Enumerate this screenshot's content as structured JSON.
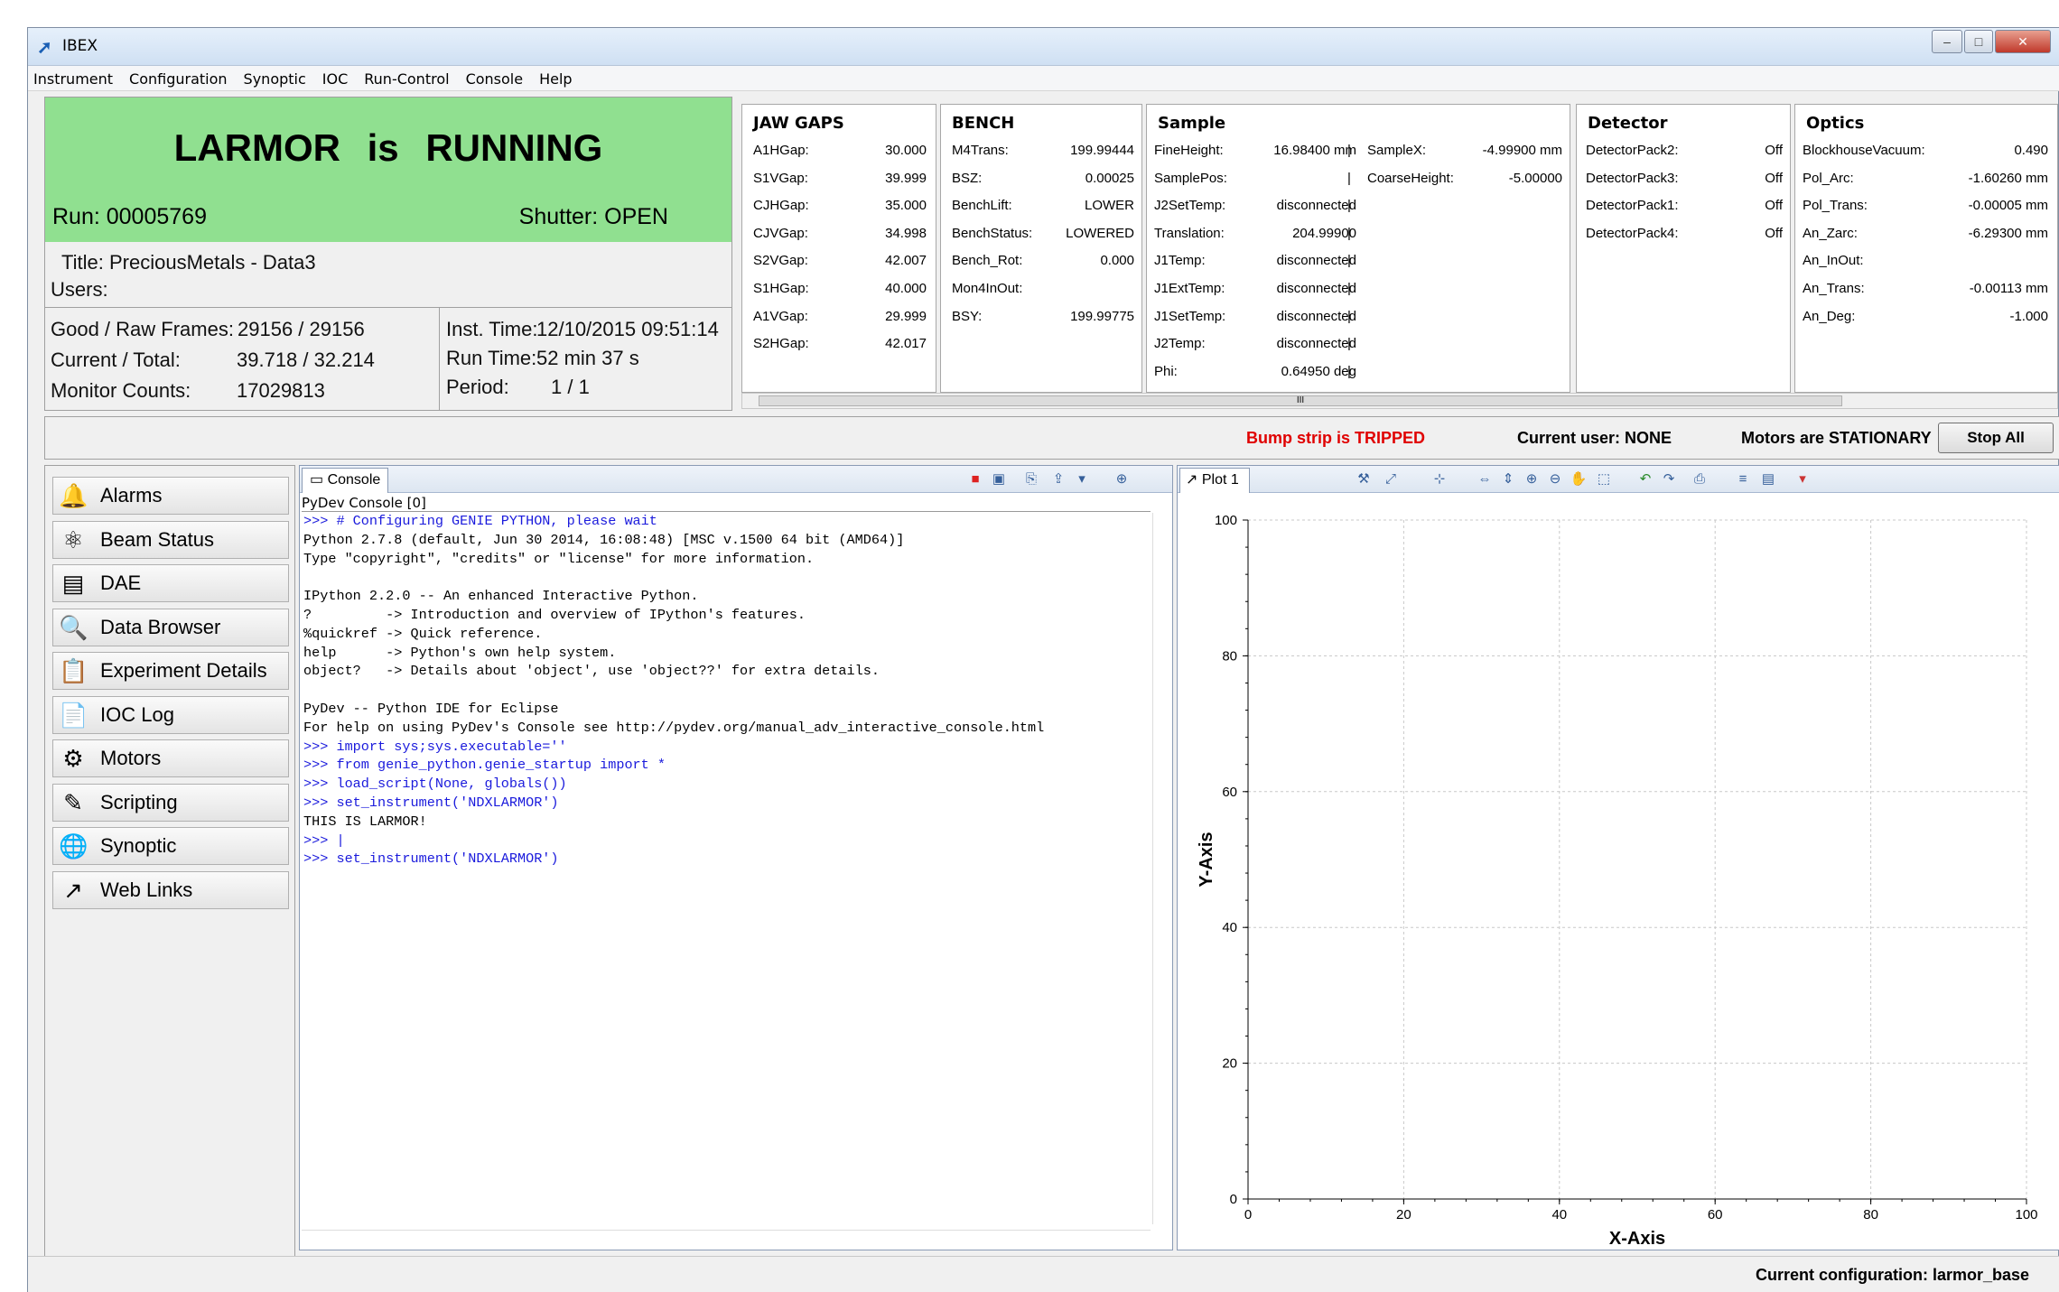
{
  "window": {
    "title": "IBEX",
    "btn_min": "–",
    "btn_max": "□",
    "btn_close": "✕"
  },
  "menu": [
    "Instrument",
    "Configuration",
    "Synoptic",
    "IOC",
    "Run-Control",
    "Console",
    "Help"
  ],
  "status": {
    "headline": "LARMOR is RUNNING",
    "run": "Run: 00005769",
    "shutter": "Shutter: OPEN",
    "title": "Title: PreciousMetals - Data3",
    "users": "Users:",
    "frames_label": "Good / Raw Frames:",
    "frames": "29156 / 29156",
    "current_label": "Current / Total:",
    "current": "39.718 / 32.214",
    "monitor_label": "Monitor Counts:",
    "monitor": "17029813",
    "inst_time_label": "Inst. Time:",
    "inst_time": "12/10/2015 09:51:14",
    "run_time_label": "Run Time:",
    "run_time": "52 min 37 s",
    "period_label": "Period:",
    "period": "1 / 1"
  },
  "blocks": {
    "jaw": {
      "title": "JAW GAPS",
      "rows": [
        [
          "A1HGap:",
          "30.000"
        ],
        [
          "S1VGap:",
          "39.999"
        ],
        [
          "CJHGap:",
          "35.000"
        ],
        [
          "CJVGap:",
          "34.998"
        ],
        [
          "S2VGap:",
          "42.007"
        ],
        [
          "S1HGap:",
          "40.000"
        ],
        [
          "A1VGap:",
          "29.999"
        ],
        [
          "S2HGap:",
          "42.017"
        ]
      ]
    },
    "bench": {
      "title": "BENCH",
      "rows": [
        [
          "M4Trans:",
          "199.99444"
        ],
        [
          "BSZ:",
          "0.00025"
        ],
        [
          "BenchLift:",
          "LOWER"
        ],
        [
          "BenchStatus:",
          "LOWERED"
        ],
        [
          "Bench_Rot:",
          "0.000"
        ],
        [
          "Mon4InOut:",
          ""
        ],
        [
          "BSY:",
          "199.99775"
        ]
      ]
    },
    "sample": {
      "title": "Sample",
      "rows": [
        [
          "FineHeight:",
          "16.98400 mm"
        ],
        [
          "SamplePos:",
          ""
        ],
        [
          "J2SetTemp:",
          "disconnected"
        ],
        [
          "Translation:",
          "204.99900"
        ],
        [
          "J1Temp:",
          "disconnected"
        ],
        [
          "J1ExtTemp:",
          "disconnected"
        ],
        [
          "J1SetTemp:",
          "disconnected"
        ],
        [
          "J2Temp:",
          "disconnected"
        ],
        [
          "Phi:",
          "0.64950 deg"
        ]
      ],
      "rows2": [
        [
          "SampleX:",
          "-4.99900 mm"
        ],
        [
          "CoarseHeight:",
          "-5.00000"
        ]
      ],
      "sep": "|"
    },
    "detector": {
      "title": "Detector",
      "rows": [
        [
          "DetectorPack2:",
          "Off"
        ],
        [
          "DetectorPack3:",
          "Off"
        ],
        [
          "DetectorPack1:",
          "Off"
        ],
        [
          "DetectorPack4:",
          "Off"
        ]
      ]
    },
    "optics": {
      "title": "Optics",
      "rows": [
        [
          "BlockhouseVacuum:",
          "0.490"
        ],
        [
          "Pol_Arc:",
          "-1.60260 mm"
        ],
        [
          "Pol_Trans:",
          "-0.00005 mm"
        ],
        [
          "An_Zarc:",
          "-6.29300 mm"
        ],
        [
          "An_InOut:",
          ""
        ],
        [
          "An_Trans:",
          "-0.00113 mm"
        ],
        [
          "An_Deg:",
          "-1.000"
        ]
      ]
    },
    "scroll_mark": "III"
  },
  "bump": {
    "warning": "Bump strip is TRIPPED",
    "user": "Current user: NONE",
    "motors": "Motors are STATIONARY",
    "stop": "Stop All",
    "warn_color": "#e00000"
  },
  "nav": [
    {
      "label": "Alarms",
      "icon": "bell-icon",
      "glyph": "🔔"
    },
    {
      "label": "Beam Status",
      "icon": "atom-icon",
      "glyph": "⚛"
    },
    {
      "label": "DAE",
      "icon": "dae-icon",
      "glyph": "▤"
    },
    {
      "label": "Data Browser",
      "icon": "chart-search-icon",
      "glyph": "🔍"
    },
    {
      "label": "Experiment Details",
      "icon": "document-icon",
      "glyph": "📋"
    },
    {
      "label": "IOC Log",
      "icon": "log-icon",
      "glyph": "📄"
    },
    {
      "label": "Motors",
      "icon": "gears-icon",
      "glyph": "⚙"
    },
    {
      "label": "Scripting",
      "icon": "edit-icon",
      "glyph": "✎"
    },
    {
      "label": "Synoptic",
      "icon": "globe-icon",
      "glyph": "🌐"
    },
    {
      "label": "Web Links",
      "icon": "external-link-icon",
      "glyph": "↗"
    }
  ],
  "console": {
    "tab": "Console",
    "subtitle": "PyDev Console [0]",
    "lines": [
      {
        "t": ">>> # Configuring GENIE PYTHON, please wait",
        "in": true
      },
      {
        "t": "Python 2.7.8 (default, Jun 30 2014, 16:08:48) [MSC v.1500 64 bit (AMD64)]",
        "in": false
      },
      {
        "t": "Type \"copyright\", \"credits\" or \"license\" for more information.",
        "in": false
      },
      {
        "t": "",
        "in": false
      },
      {
        "t": "IPython 2.2.0 -- An enhanced Interactive Python.",
        "in": false
      },
      {
        "t": "?         -> Introduction and overview of IPython's features.",
        "in": false
      },
      {
        "t": "%quickref -> Quick reference.",
        "in": false
      },
      {
        "t": "help      -> Python's own help system.",
        "in": false
      },
      {
        "t": "object?   -> Details about 'object', use 'object??' for extra details.",
        "in": false
      },
      {
        "t": "",
        "in": false
      },
      {
        "t": "PyDev -- Python IDE for Eclipse",
        "in": false
      },
      {
        "t": "For help on using PyDev's Console see http://pydev.org/manual_adv_interactive_console.html",
        "in": false
      },
      {
        "t": ">>> import sys;sys.executable=''",
        "in": true
      },
      {
        "t": ">>> from genie_python.genie_startup import *",
        "in": true
      },
      {
        "t": ">>> load_script(None, globals())",
        "in": true
      },
      {
        "t": ">>> set_instrument('NDXLARMOR')",
        "in": true
      },
      {
        "t": "THIS IS LARMOR!",
        "in": false
      },
      {
        "t": ">>> |",
        "in": true
      },
      {
        "t": ">>> set_instrument('NDXLARMOR')",
        "in": true
      }
    ]
  },
  "plot": {
    "tab": "Plot 1"
  },
  "chart_data": {
    "type": "line",
    "title": "",
    "xlabel": "X-Axis",
    "ylabel": "Y-Axis",
    "xlim": [
      0,
      100
    ],
    "ylim": [
      0,
      100
    ],
    "xticks": [
      0,
      20,
      40,
      60,
      80,
      100
    ],
    "yticks": [
      0,
      20,
      40,
      60,
      80,
      100
    ],
    "series": [],
    "grid": true
  },
  "footer": {
    "config": "Current configuration: larmor_base"
  }
}
